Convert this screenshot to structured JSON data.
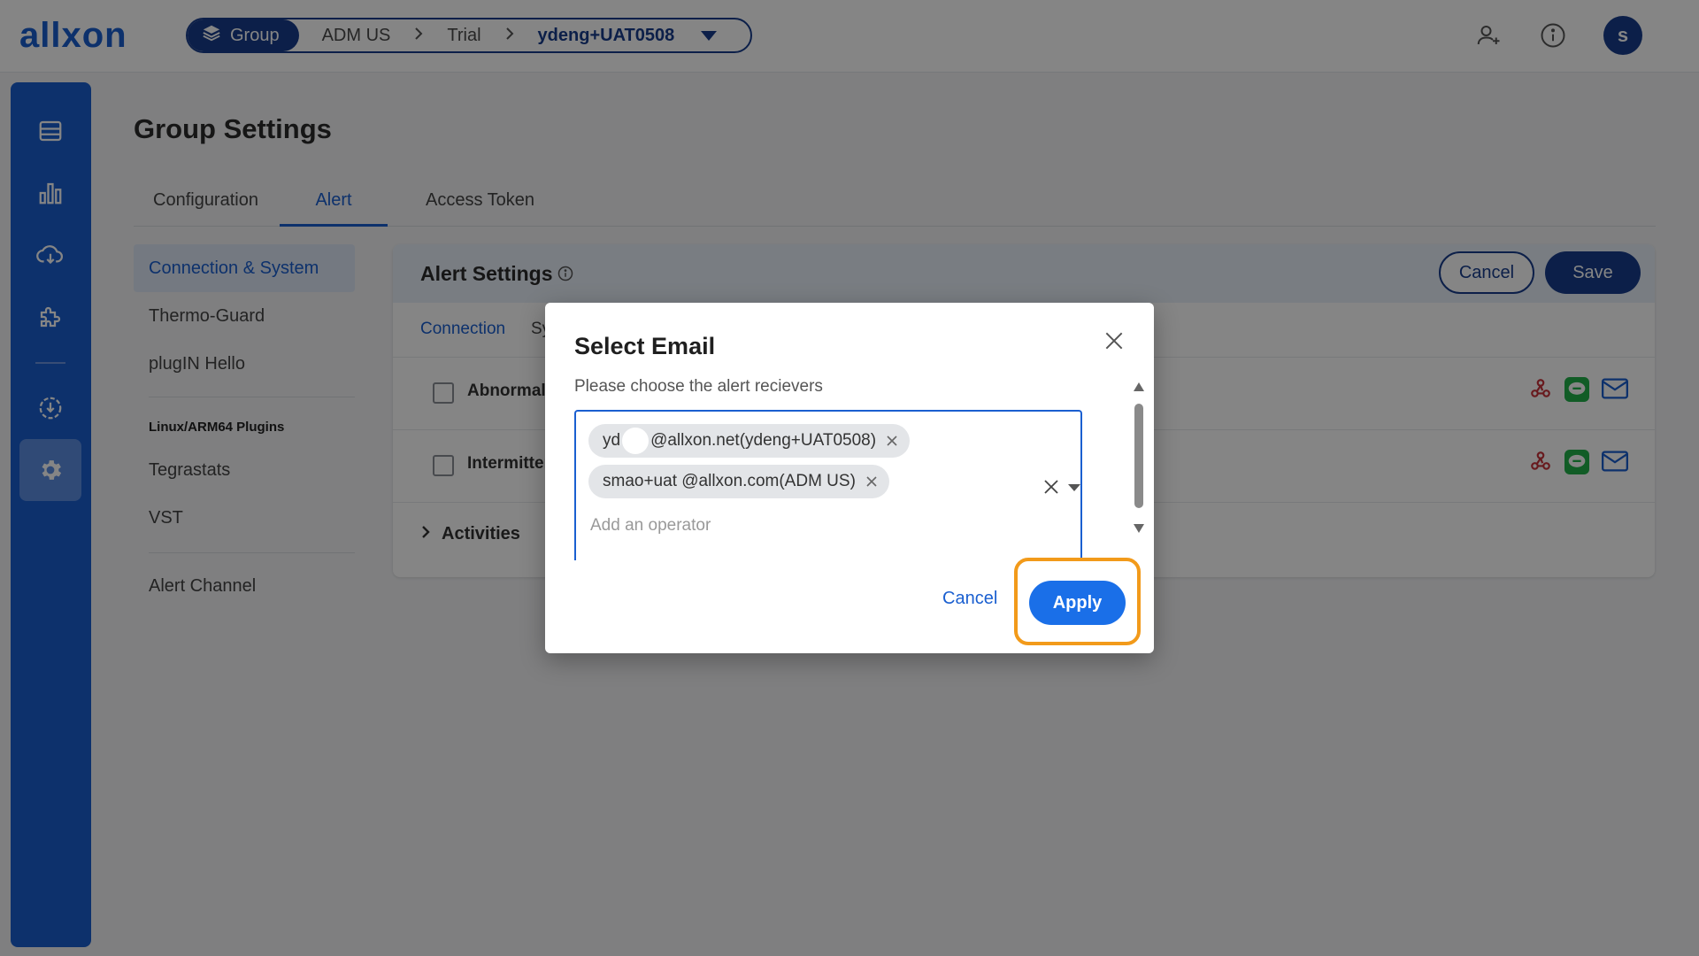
{
  "header": {
    "logo_text": "allxon",
    "breadcrumb": {
      "group_label": "Group",
      "items": [
        "ADM US",
        "Trial"
      ],
      "current": "ydeng+UAT0508"
    },
    "avatar_initial": "s"
  },
  "colors": {
    "brand": "#1a5fd0",
    "navy": "#173d8c",
    "highlight": "#f29a1a",
    "line_green": "#22b04a",
    "webhook_red": "#c8323a"
  },
  "rail": {
    "items": [
      "dashboard-icon",
      "chart-icon",
      "cloud-sync-icon",
      "plugin-icon",
      "ota-icon",
      "settings-icon"
    ],
    "active": "settings-icon"
  },
  "page": {
    "title": "Group Settings",
    "tabs": [
      "Configuration",
      "Alert",
      "Access Token"
    ],
    "active_tab": "Alert"
  },
  "subnav": {
    "items": [
      "Connection & System",
      "Thermo-Guard",
      "plugIN Hello"
    ],
    "active": "Connection & System",
    "section_heading": "Linux/ARM64 Plugins",
    "plugin_items": [
      "Tegrastats",
      "VST"
    ],
    "footer_item": "Alert Channel"
  },
  "alert_settings": {
    "title": "Alert Settings",
    "cancel_label": "Cancel",
    "save_label": "Save",
    "subtabs": [
      "Connection",
      "Sy"
    ],
    "rows": [
      "Abnormal",
      "Intermitter"
    ],
    "activities_label": "Activities"
  },
  "modal": {
    "title": "Select Email",
    "subtitle": "Please choose the alert recievers",
    "chips": [
      {
        "prefix": "yd",
        "suffix": "@allxon.net(ydeng+UAT0508)"
      },
      {
        "prefix": "smao+uat @allxon.com(ADM US)",
        "suffix": ""
      }
    ],
    "placeholder": "Add an operator",
    "cancel_label": "Cancel",
    "apply_label": "Apply"
  }
}
